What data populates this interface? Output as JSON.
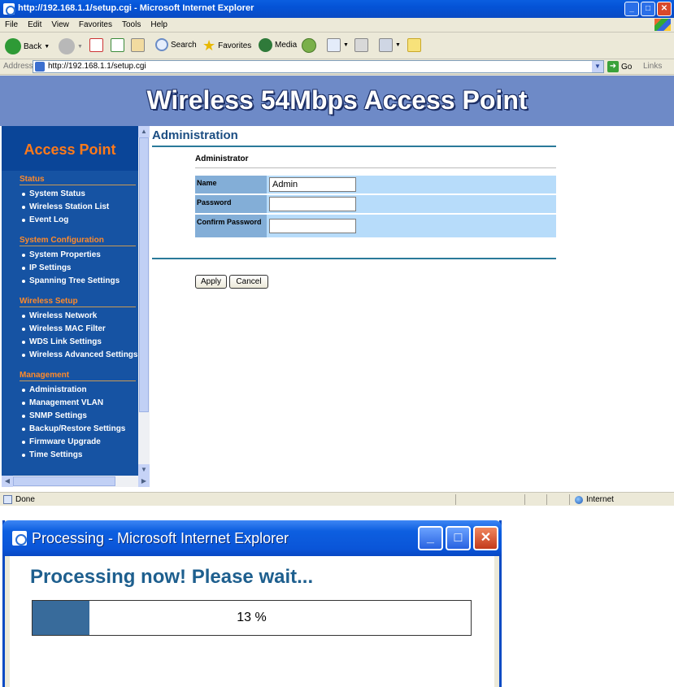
{
  "browser": {
    "title": "http://192.168.1.1/setup.cgi - Microsoft Internet Explorer",
    "menu": [
      "File",
      "Edit",
      "View",
      "Favorites",
      "Tools",
      "Help"
    ],
    "toolbar": {
      "back": "Back",
      "search": "Search",
      "favorites": "Favorites",
      "media": "Media"
    },
    "address_label": "Address",
    "address_value": "http://192.168.1.1/setup.cgi",
    "go": "Go",
    "links": "Links",
    "status_text": "Done",
    "zone": "Internet"
  },
  "page": {
    "banner": "Wireless 54Mbps Access Point",
    "sidebar_title": "Access Point",
    "sections": [
      {
        "title": "Status",
        "items": [
          "System Status",
          "Wireless Station List",
          "Event Log"
        ]
      },
      {
        "title": "System Configuration",
        "items": [
          "System Properties",
          "IP Settings",
          "Spanning Tree Settings"
        ]
      },
      {
        "title": "Wireless Setup",
        "items": [
          "Wireless Network",
          "Wireless MAC Filter",
          "WDS Link Settings",
          "Wireless Advanced Settings"
        ]
      },
      {
        "title": "Management",
        "items": [
          "Administration",
          "Management VLAN",
          "SNMP Settings",
          "Backup/Restore Settings",
          "Firmware Upgrade",
          "Time Settings"
        ]
      }
    ],
    "main": {
      "title": "Administration",
      "subtitle": "Administrator",
      "fields": [
        {
          "label": "Name",
          "value": "Admin"
        },
        {
          "label": "Password",
          "value": ""
        },
        {
          "label": "Confirm Password",
          "value": ""
        }
      ],
      "apply": "Apply",
      "cancel": "Cancel"
    }
  },
  "dialog": {
    "title": "Processing - Microsoft Internet Explorer",
    "message": "Processing now! Please wait...",
    "progress_text": "13 %",
    "progress_fraction": 0.13
  }
}
